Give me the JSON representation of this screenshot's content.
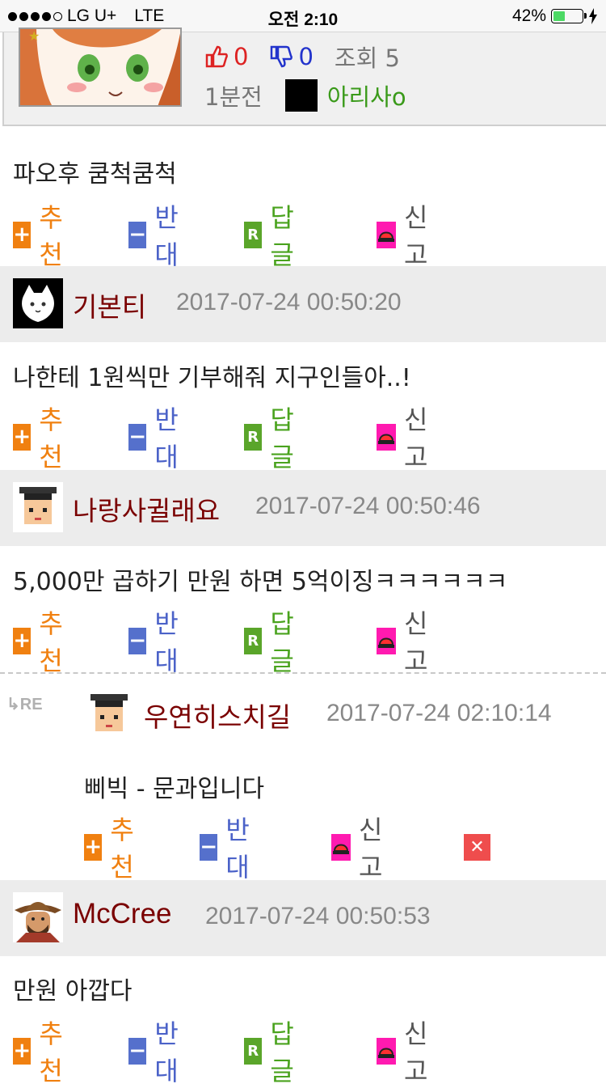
{
  "status_bar": {
    "carrier": "LG U+",
    "network": "LTE",
    "time": "오전 2:10",
    "battery": "42%",
    "battery_level": 0.42
  },
  "post": {
    "likes": "0",
    "dislikes": "0",
    "views": "조회 5",
    "time": "1분전",
    "author": "아리사o"
  },
  "actions": {
    "recommend": "추천",
    "oppose": "반대",
    "reply": "답글",
    "report": "신고"
  },
  "comments": [
    {
      "author": "",
      "time": "",
      "text": "파오후 쿰척쿰척"
    },
    {
      "author": "기본티",
      "time": "2017-07-24 00:50:20",
      "text": "나한테 1원씩만 기부해줘 지구인들아..!"
    },
    {
      "author": "나랑사귈래요",
      "time": "2017-07-24 00:50:46",
      "text": "5,000만 곱하기 만원 하면 5억이징ㅋㅋㅋㅋㅋㅋ"
    },
    {
      "author": "McCree",
      "time": "2017-07-24 00:50:53",
      "text": "만원 아깝다"
    }
  ],
  "reply": {
    "marker": "RE",
    "author": "우연히스치길",
    "time": "2017-07-24 02:10:14",
    "text": "삐빅 - 문과입니다"
  },
  "colors": {
    "recommend": "#f08010",
    "oppose": "#4b62c8",
    "reply": "#4aa31e",
    "report": "#ff1ab0",
    "author_name": "#7a0000"
  }
}
